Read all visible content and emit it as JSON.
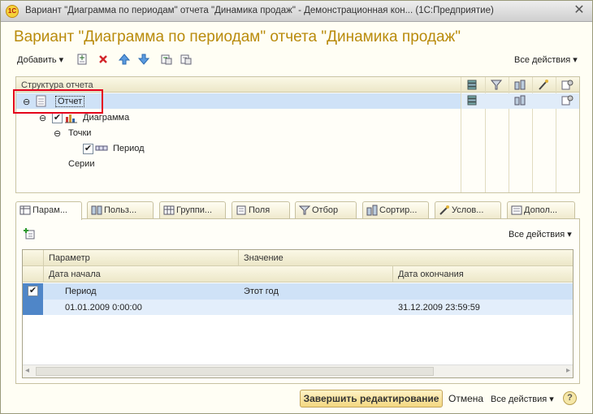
{
  "window": {
    "app_logo": "1С",
    "title": "Вариант \"Диаграмма по периодам\" отчета \"Динамика продаж\" - Демонстрационная кон...  (1С:Предприятие)",
    "close_glyph": "✕"
  },
  "form": {
    "title": "Вариант \"Диаграмма по периодам\" отчета \"Динамика продаж\""
  },
  "toolbar": {
    "add_label": "Добавить",
    "all_actions_label": "Все действия",
    "icons": [
      "add-group-icon",
      "delete-icon",
      "move-up-icon",
      "move-down-icon",
      "group-icon",
      "ungroup-icon"
    ]
  },
  "tree": {
    "header_label": "Структура отчета",
    "items": [
      {
        "label": "Отчет",
        "expander": "⊖",
        "selected": true
      },
      {
        "label": "Диаграмма",
        "expander": "⊖",
        "checked": true
      },
      {
        "label": "Точки",
        "expander": "⊖"
      },
      {
        "label": "Период",
        "checked": true
      },
      {
        "label": "Серии"
      }
    ],
    "column_icons": [
      "fields-icon",
      "filter-icon",
      "sort-icon",
      "conditional-format-icon",
      "other-settings-icon"
    ]
  },
  "tabs": [
    {
      "label": "Парам...",
      "active": true
    },
    {
      "label": "Польз..."
    },
    {
      "label": "Группи..."
    },
    {
      "label": "Поля"
    },
    {
      "label": "Отбор"
    },
    {
      "label": "Сортир..."
    },
    {
      "label": "Услов..."
    },
    {
      "label": "Допол..."
    }
  ],
  "params_panel": {
    "all_actions_label": "Все действия",
    "columns": {
      "parameter": "Параметр",
      "value": "Значение",
      "start_date": "Дата начала",
      "end_date": "Дата окончания"
    },
    "row": {
      "checked": true,
      "parameter": "Период",
      "value": "Этот год",
      "start": "01.01.2009 0:00:00",
      "end": "31.12.2009 23:59:59"
    }
  },
  "footer": {
    "finish_label": "Завершить редактирование",
    "cancel_label": "Отмена",
    "all_actions_label": "Все действия",
    "help_label": "?"
  },
  "colors": {
    "title_accent": "#b98b0c",
    "selection": "#cfe2f7",
    "highlight_box": "#e4001b"
  }
}
